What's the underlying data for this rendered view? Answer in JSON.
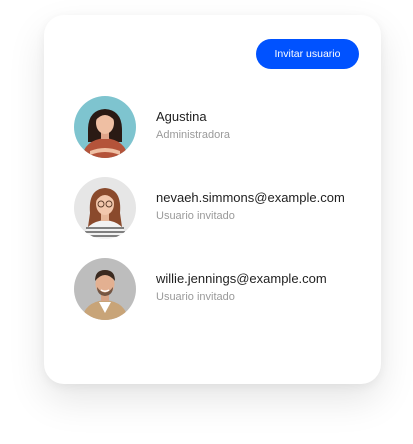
{
  "header": {
    "invite_button_label": "Invitar usuario"
  },
  "users": [
    {
      "name": "Agustina",
      "role": "Administradora",
      "avatar_icon": "user-photo-avatar",
      "avatar_bg": "#7ec4cf"
    },
    {
      "name": "nevaeh.simmons@example.com",
      "role": "Usuario invitado",
      "avatar_icon": "user-photo-avatar",
      "avatar_bg": "#e6e6e6"
    },
    {
      "name": "willie.jennings@example.com",
      "role": "Usuario invitado",
      "avatar_icon": "user-photo-avatar",
      "avatar_bg": "#bdbdbd"
    }
  ],
  "colors": {
    "accent": "#0052ff",
    "name_text": "#1f1f1f",
    "role_text": "#9a9a9a"
  }
}
